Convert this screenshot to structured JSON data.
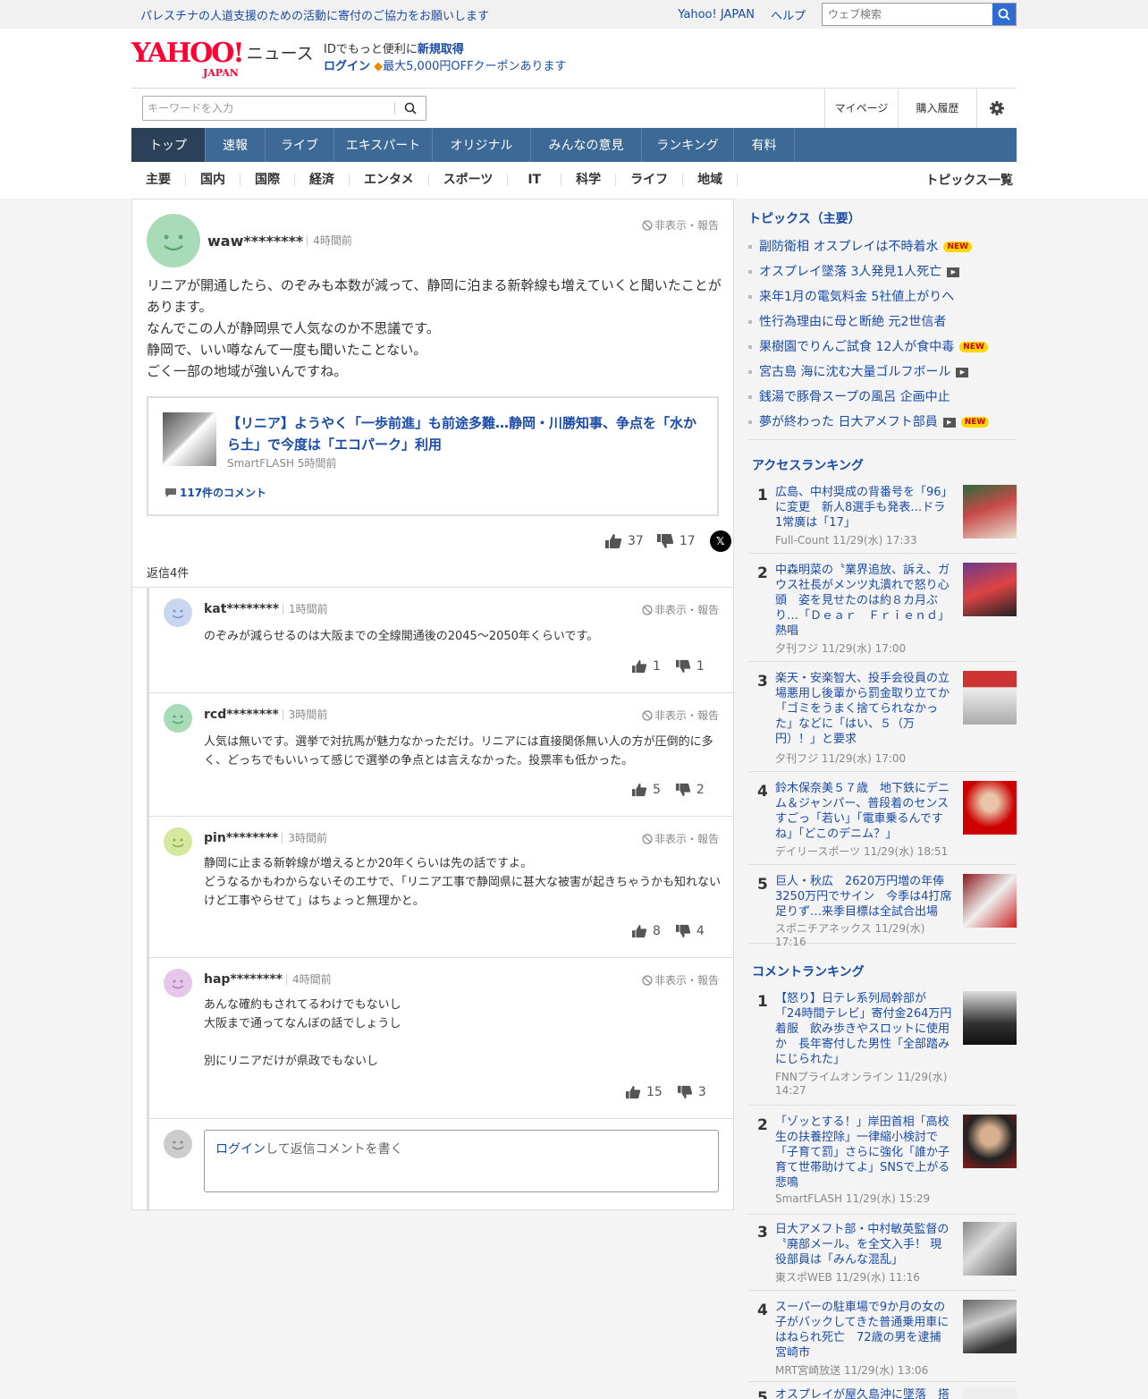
{
  "topbar": {
    "notice": "パレスチナの人道支援のための活動に寄付のご協力をお願いします",
    "links": [
      "Yahoo! JAPAN",
      "ヘルプ"
    ],
    "search_placeholder": "ウェブ検索"
  },
  "header": {
    "logo": "YAHOO!",
    "logo_sub": "JAPAN",
    "section": "ニュース",
    "id_text": "IDでもっと便利に",
    "signup": "新規取得",
    "login": "ログイン",
    "coupon": "最大5,000円OFFクーポンあります"
  },
  "toolbar": {
    "keyword_placeholder": "キーワードを入力",
    "mypage": "マイページ",
    "history": "購入履歴"
  },
  "mainnav": [
    "トップ",
    "速報",
    "ライブ",
    "エキスパート",
    "オリジナル",
    "みんなの意見",
    "ランキング",
    "有料"
  ],
  "subnav": [
    "主要",
    "国内",
    "国際",
    "経済",
    "エンタメ",
    "スポーツ",
    "IT",
    "科学",
    "ライフ",
    "地域"
  ],
  "subnav_right": "トピックス一覧",
  "comment": {
    "user": "waw********",
    "ago": "4時間前",
    "report": "非表示・報告",
    "body": [
      "リニアが開通したら、のぞみも本数が減って、静岡に泊まる新幹線も増えていくと聞いたことがあります。",
      "なんでこの人が静岡県で人気なのか不思議です。",
      "静岡で、いい噂なんて一度も聞いたことない。",
      "ごく一部の地域が強いんですね。"
    ],
    "article_title": "【リニア】ようやく「一歩前進」も前途多難…静岡・川勝知事、争点を「水から土」で今度は「エコパーク」利用",
    "article_source": "SmartFLASH 5時間前",
    "article_comments": "117件のコメント",
    "likes": "37",
    "dislikes": "17",
    "x_label": "𝕏",
    "reply_count": "返信4件"
  },
  "replies": [
    {
      "user": "kat********",
      "ago": "1時間前",
      "text": [
        "のぞみが減らせるのは大阪までの全線開通後の2045〜2050年くらいです。"
      ],
      "likes": "1",
      "dislikes": "1",
      "color": "#c9d6f0"
    },
    {
      "user": "rcd********",
      "ago": "3時間前",
      "text": [
        "人気は無いです。選挙で対抗馬が魅力なかっただけ。リニアには直接関係無い人の方が圧倒的に多く、どっちでもいいって感じで選挙の争点とは言えなかった。投票率も低かった。"
      ],
      "likes": "5",
      "dislikes": "2",
      "color": "#a8dcb8"
    },
    {
      "user": "pin********",
      "ago": "3時間前",
      "text": [
        "静岡に止まる新幹線が増えるとか20年くらいは先の話ですよ。",
        "どうなるかもわからないそのエサで、「リニア工事で静岡県に甚大な被害が起きちゃうかも知れないけど工事やらせて」はちょっと無理かと。"
      ],
      "likes": "8",
      "dislikes": "4",
      "color": "#d4e8a0"
    },
    {
      "user": "hap********",
      "ago": "4時間前",
      "text": [
        "あんな確約もされてるわけでもないし",
        "大阪まで通ってなんぼの話でしょうし",
        "",
        "別にリニアだけが県政でもないし"
      ],
      "likes": "15",
      "dislikes": "3",
      "color": "#e6c6ea"
    }
  ],
  "reply_input": {
    "login": "ログイン",
    "rest": "して返信コメントを書く"
  },
  "topics": {
    "title": "トピックス（主要）",
    "items": [
      {
        "text": "副防衛相 オスプレイは不時着水",
        "new": true,
        "video": false
      },
      {
        "text": "オスプレイ墜落 3人発見1人死亡",
        "new": false,
        "video": true
      },
      {
        "text": "来年1月の電気料金 5社値上がりへ",
        "new": false,
        "video": false
      },
      {
        "text": "性行為理由に母と断絶 元2世信者",
        "new": false,
        "video": false
      },
      {
        "text": "果樹園でりんご試食 12人が食中毒",
        "new": true,
        "video": false
      },
      {
        "text": "宮古島 海に沈む大量ゴルフボール",
        "new": false,
        "video": true
      },
      {
        "text": "銭湯で豚骨スープの風呂 企画中止",
        "new": false,
        "video": false
      },
      {
        "text": "夢が終わった 日大アメフト部員",
        "new": true,
        "video": true
      }
    ],
    "new_label": "NEW"
  },
  "access_ranking": {
    "title": "アクセスランキング",
    "items": [
      {
        "num": "1",
        "title": "広島、中村奨成の背番号を「96」に変更　新人8選手も発表…ドラ1常廣は「17」",
        "source": "Full-Count 11/29(水) 17:33"
      },
      {
        "num": "2",
        "title": "中森明菜の〝業界追放、訴え、ガウス社長がメンツ丸潰れで怒り心頭　姿を見せたのは約８カ月ぶり…「Ｄｅａｒ　Ｆｒｉｅｎｄ」熱唱",
        "source": "夕刊フジ 11/29(水) 17:00"
      },
      {
        "num": "3",
        "title": "楽天・安楽智大、投手会役員の立場悪用し後輩から罰金取り立てか「ゴミをうまく捨てられなかった」などに「はい、５（万円）！」と要求",
        "source": "夕刊フジ 11/29(水) 17:00"
      },
      {
        "num": "4",
        "title": "鈴木保奈美５７歳　地下鉄にデニム＆ジャンパー、普段着のセンスすごっ「若い」「電車乗るんですね」「どこのデニム？」",
        "source": "デイリースポーツ 11/29(水) 18:51"
      },
      {
        "num": "5",
        "title": "巨人・秋広　2620万円増の年俸3250万円でサイン　今季は4打席足りず…来季目標は全試合出場",
        "source": "スポニチアネックス 11/29(水) 17:16"
      }
    ]
  },
  "comment_ranking": {
    "title": "コメントランキング",
    "items": [
      {
        "num": "1",
        "title": "【怒り】日テレ系列局幹部が「24時間テレビ」寄付金264万円着服　飲み歩きやスロットに使用か　長年寄付した男性「全部踏みにじられた」",
        "source": "FNNプライムオンライン 11/29(水) 14:27"
      },
      {
        "num": "2",
        "title": "「ゾッとする！」岸田首相「高校生の扶養控除」一律縮小検討で「子育て罰」さらに強化「誰か子育て世帯助けてよ」SNSで上がる悲鳴",
        "source": "SmartFLASH 11/29(水) 15:29"
      },
      {
        "num": "3",
        "title": "日大アメフト部・中村敏英監督の〝廃部メール〟を全文入手！ 現役部員は「みんな混乱」",
        "source": "東スポWEB 11/29(水) 11:16"
      },
      {
        "num": "4",
        "title": "スーパーの駐車場で9か月の女の子がバックしてきた普通乗用車にはねられ死亡　72歳の男を逮捕　宮崎市",
        "source": "MRT宮崎放送 11/29(水) 13:06"
      },
      {
        "num": "5",
        "title": "オスプレイが屋久島沖に墜落　搭",
        "source": ""
      }
    ]
  }
}
